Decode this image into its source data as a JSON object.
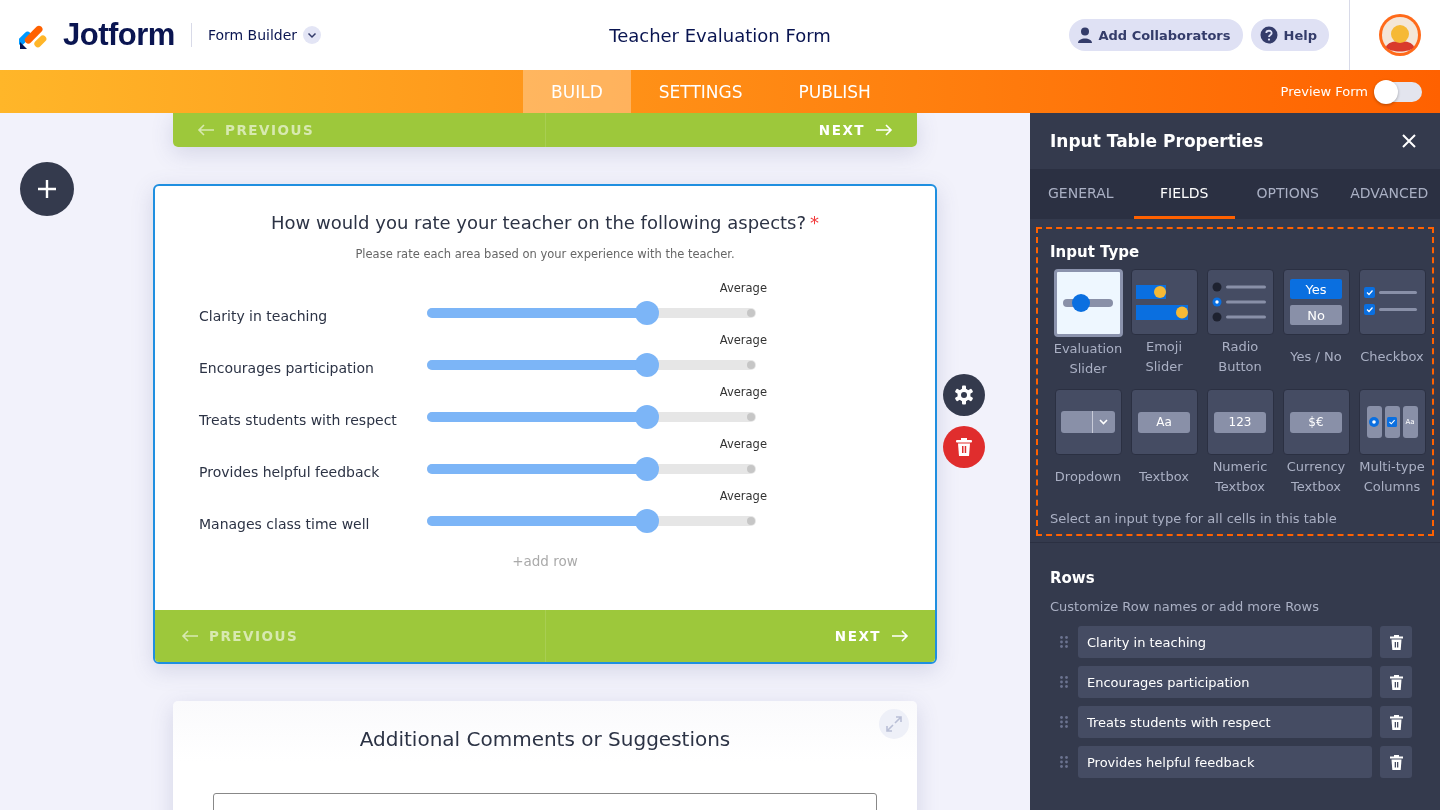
{
  "header": {
    "logo": "Jotform",
    "product": "Form Builder",
    "form_title": "Teacher Evaluation Form",
    "buttons": [
      {
        "label": "Add Collaborators",
        "kind": "collaborators"
      },
      {
        "label": "Help",
        "kind": "help"
      }
    ]
  },
  "nav": {
    "tabs": [
      {
        "label": "BUILD",
        "selected": true
      },
      {
        "label": "SETTINGS",
        "selected": false
      },
      {
        "label": "PUBLISH",
        "selected": false
      }
    ],
    "preview": {
      "label": "Preview Form",
      "on": false
    }
  },
  "canvas": {
    "previous_page_nav": {
      "previous": "PREVIOUS",
      "next": "NEXT"
    },
    "question": {
      "title": "How would you rate your teacher on the following aspects?",
      "required": true,
      "required_mark": "*",
      "subtitle": "Please rate each area based on your experience with the teacher.",
      "rows": [
        {
          "label": "Clarity in teaching",
          "level": 0.67,
          "reading": "Average"
        },
        {
          "label": "Encourages participation",
          "level": 0.67,
          "reading": "Average"
        },
        {
          "label": "Treats students with respect",
          "level": 0.67,
          "reading": "Average"
        },
        {
          "label": "Provides helpful feedback",
          "level": 0.67,
          "reading": "Average"
        },
        {
          "label": "Manages class time well",
          "level": 0.67,
          "reading": "Average"
        }
      ],
      "add_row": "+add row",
      "previous": "PREVIOUS",
      "next": "NEXT"
    },
    "comments": {
      "title": "Additional Comments or Suggestions"
    }
  },
  "panel": {
    "title": "Input Table Properties",
    "tabs": [
      {
        "label": "GENERAL",
        "selected": false
      },
      {
        "label": "FIELDS",
        "selected": true
      },
      {
        "label": "OPTIONS",
        "selected": false
      },
      {
        "label": "ADVANCED",
        "selected": false
      }
    ],
    "input_type": {
      "heading": "Input Type",
      "options": [
        {
          "label": "Evaluation Slider",
          "kind": "slider",
          "selected": true
        },
        {
          "label": "Emoji Slider",
          "kind": "emoji",
          "selected": false
        },
        {
          "label": "Radio Button",
          "kind": "radio",
          "selected": false
        },
        {
          "label": "Yes / No",
          "kind": "yesno",
          "selected": false,
          "icon_texts": [
            "Yes",
            "No"
          ]
        },
        {
          "label": "Checkbox",
          "kind": "checkbox",
          "selected": false
        },
        {
          "label": "Dropdown",
          "kind": "dropdown",
          "selected": false
        },
        {
          "label": "Textbox",
          "kind": "text",
          "selected": false,
          "icon_text": "Aa"
        },
        {
          "label": "Numeric Textbox",
          "kind": "text",
          "selected": false,
          "icon_text": "123"
        },
        {
          "label": "Currency Textbox",
          "kind": "text",
          "selected": false,
          "icon_text": "$€"
        },
        {
          "label": "Multi-type Columns",
          "kind": "multi",
          "selected": false,
          "icon_text": "Aa"
        }
      ],
      "hint": "Select an input type for all cells in this table"
    },
    "rows": {
      "heading": "Rows",
      "hint": "Customize Row names or add more Rows",
      "items": [
        "Clarity in teaching",
        "Encourages participation",
        "Treats students with respect",
        "Provides helpful feedback"
      ]
    }
  }
}
